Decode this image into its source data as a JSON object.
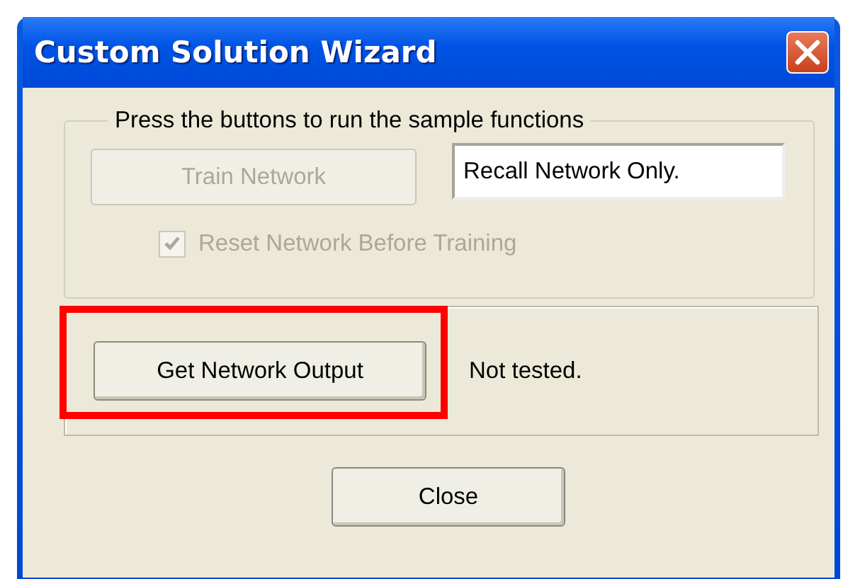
{
  "window": {
    "title": "Custom Solution Wizard"
  },
  "group": {
    "legend": "Press the buttons to run the sample functions",
    "train_button": {
      "label": "Train Network",
      "disabled": true
    },
    "mode_field": {
      "value": "Recall Network Only."
    },
    "reset_checkbox": {
      "label": "Reset Network Before Training",
      "checked": true,
      "disabled": true
    }
  },
  "output_panel": {
    "button": {
      "label": "Get Network Output",
      "highlighted": true
    },
    "status": "Not tested."
  },
  "buttons": [
    {
      "label": "Close"
    }
  ]
}
